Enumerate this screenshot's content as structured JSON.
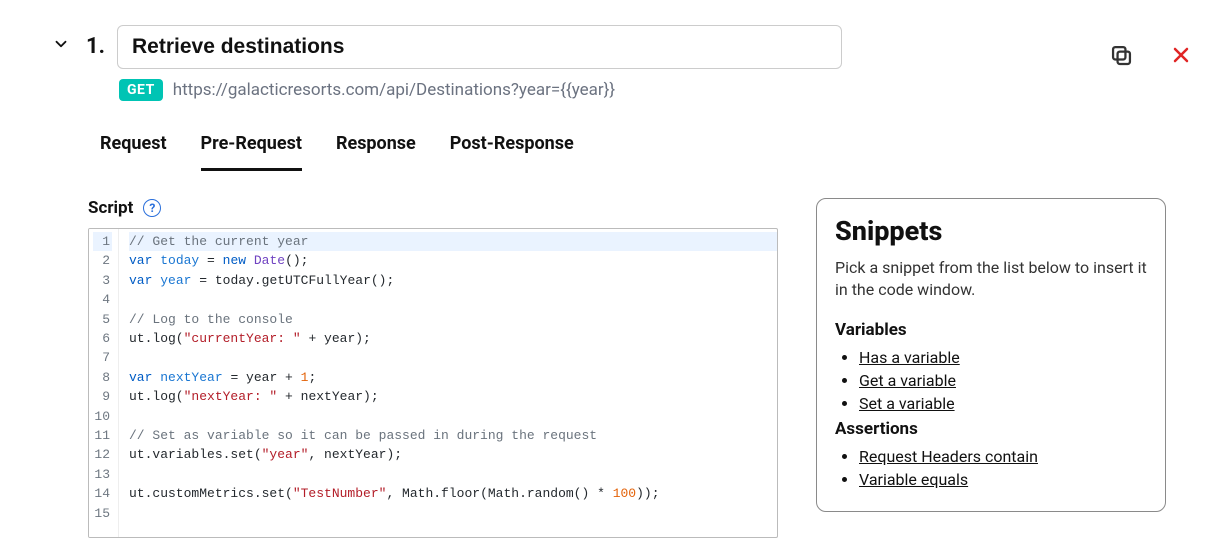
{
  "step": {
    "number": "1."
  },
  "header": {
    "title": "Retrieve destinations",
    "method": "GET",
    "url": "https://galacticresorts.com/api/Destinations?year={{year}}"
  },
  "tabs": [
    "Request",
    "Pre-Request",
    "Response",
    "Post-Response"
  ],
  "active_tab": 1,
  "script": {
    "label": "Script",
    "help_glyph": "?",
    "lines": [
      {
        "n": 1,
        "tokens": [
          {
            "t": "// Get the current year",
            "cls": "c-com"
          }
        ]
      },
      {
        "n": 2,
        "tokens": [
          {
            "t": "var ",
            "cls": "c-kw"
          },
          {
            "t": "today",
            "cls": "c-var"
          },
          {
            "t": " = "
          },
          {
            "t": "new ",
            "cls": "c-new"
          },
          {
            "t": "Date",
            "cls": "c-typ"
          },
          {
            "t": "();"
          }
        ]
      },
      {
        "n": 3,
        "tokens": [
          {
            "t": "var ",
            "cls": "c-kw"
          },
          {
            "t": "year",
            "cls": "c-var"
          },
          {
            "t": " = today.getUTCFullYear();"
          }
        ]
      },
      {
        "n": 4,
        "tokens": []
      },
      {
        "n": 5,
        "tokens": [
          {
            "t": "// Log to the console",
            "cls": "c-com"
          }
        ]
      },
      {
        "n": 6,
        "tokens": [
          {
            "t": "ut.log("
          },
          {
            "t": "\"currentYear: \"",
            "cls": "c-str"
          },
          {
            "t": " + year);"
          }
        ]
      },
      {
        "n": 7,
        "tokens": []
      },
      {
        "n": 8,
        "tokens": [
          {
            "t": "var ",
            "cls": "c-kw"
          },
          {
            "t": "nextYear",
            "cls": "c-var"
          },
          {
            "t": " = year + "
          },
          {
            "t": "1",
            "cls": "c-num"
          },
          {
            "t": ";"
          }
        ]
      },
      {
        "n": 9,
        "tokens": [
          {
            "t": "ut.log("
          },
          {
            "t": "\"nextYear: \"",
            "cls": "c-str"
          },
          {
            "t": " + nextYear);"
          }
        ]
      },
      {
        "n": 10,
        "tokens": []
      },
      {
        "n": 11,
        "tokens": [
          {
            "t": "// Set as variable so it can be passed in during the request",
            "cls": "c-com"
          }
        ]
      },
      {
        "n": 12,
        "tokens": [
          {
            "t": "ut.variables.set("
          },
          {
            "t": "\"year\"",
            "cls": "c-str"
          },
          {
            "t": ", nextYear);"
          }
        ]
      },
      {
        "n": 13,
        "tokens": []
      },
      {
        "n": 14,
        "tokens": [
          {
            "t": "ut.customMetrics.set("
          },
          {
            "t": "\"TestNumber\"",
            "cls": "c-str"
          },
          {
            "t": ", Math.floor(Math.random() * "
          },
          {
            "t": "100",
            "cls": "c-num"
          },
          {
            "t": "));"
          }
        ]
      },
      {
        "n": 15,
        "tokens": []
      }
    ]
  },
  "snippets": {
    "title": "Snippets",
    "blurb": "Pick a snippet from the list below to insert it in the code window.",
    "groups": [
      {
        "heading": "Variables",
        "items": [
          "Has a variable",
          "Get a variable",
          "Set a variable"
        ]
      },
      {
        "heading": "Assertions",
        "items": [
          "Request Headers contain",
          "Variable equals"
        ]
      }
    ]
  }
}
